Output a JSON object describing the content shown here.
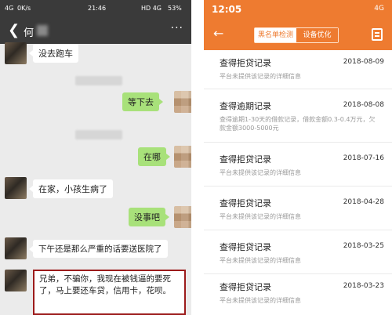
{
  "left_phone": {
    "status_bar": {
      "network": "4G",
      "speed": "0K/s",
      "time": "21:46",
      "signal_right": "HD 4G",
      "battery": "53%"
    },
    "header": {
      "title": "何"
    },
    "messages": [
      {
        "side": "left",
        "text": "没去跑车"
      },
      {
        "side": "right",
        "text": "等下去"
      },
      {
        "side": "right",
        "text": "在哪"
      },
      {
        "side": "left",
        "text": "在家，小孩生病了"
      },
      {
        "side": "right",
        "text": "没事吧"
      },
      {
        "side": "left",
        "text": "下午还是那么严重的话要送医院了"
      },
      {
        "side": "left",
        "text": "兄弟，不骗你，我现在被钱逼的要死了，马上要还车贷，信用卡，花呗。"
      }
    ]
  },
  "right_phone": {
    "status_bar": {
      "time": "12:05",
      "signal": "4G"
    },
    "header": {
      "tabs": [
        "黑名单检测",
        "设备优化"
      ],
      "active_tab": 0
    },
    "records": [
      {
        "title": "查得拒贷记录",
        "date": "2018-08-09",
        "desc": "平台未提供该记录的详细信息"
      },
      {
        "title": "查得逾期记录",
        "date": "2018-08-08",
        "desc": "查得逾期1-30天的借款记录，借款金额0.3-0.4万元，欠款金额3000-5000元"
      },
      {
        "title": "查得拒贷记录",
        "date": "2018-07-16",
        "desc": "平台未提供该记录的详细信息"
      },
      {
        "title": "查得拒贷记录",
        "date": "2018-04-28",
        "desc": "平台未提供该记录的详细信息"
      },
      {
        "title": "查得拒贷记录",
        "date": "2018-03-25",
        "desc": "平台未提供该记录的详细信息"
      },
      {
        "title": "查得拒贷记录",
        "date": "2018-03-23",
        "desc": "平台未提供该记录的详细信息"
      }
    ]
  },
  "colors": {
    "chat_bg": "#ebebeb",
    "chat_header": "#3a3a3a",
    "green_bubble": "#a8e17a",
    "app_orange": "#ee7b30",
    "highlight_border": "#9c1b1b"
  }
}
